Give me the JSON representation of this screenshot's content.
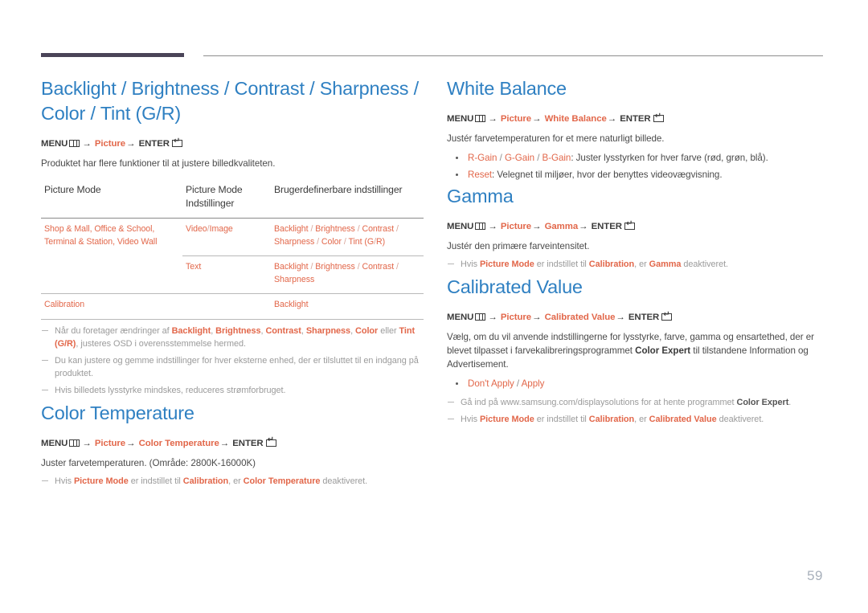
{
  "page": {
    "number": "59",
    "accent_blue": "#2f80c2",
    "accent_orange": "#e2674a",
    "rule_dark": "#4a4458"
  },
  "menu_labels": {
    "menu": "MENU",
    "enter": "ENTER",
    "arrow": "→",
    "menu_icon": "menu-grid-icon",
    "enter_icon": "enter-key-icon"
  },
  "left": {
    "section1": {
      "title": "Backlight / Brightness / Contrast / Sharpness / Color / Tint (G/R)",
      "path": {
        "root": "Picture"
      },
      "intro": "Produktet har flere funktioner til at justere billedkvaliteten.",
      "table": {
        "headers": [
          "Picture Mode",
          "Picture Mode Indstillinger",
          "Brugerdefinerbare indstillinger"
        ],
        "rows": [
          {
            "mode": "Shop & Mall, Office & School, Terminal & Station, Video Wall",
            "setting": "Video/Image",
            "custom": "Backlight / Brightness / Contrast / Sharpness / Color / Tint (G/R)"
          },
          {
            "mode": "",
            "setting": "Text",
            "custom": "Backlight / Brightness / Contrast / Sharpness"
          },
          {
            "mode": "Calibration",
            "setting": "",
            "custom": "Backlight"
          }
        ]
      },
      "notes": [
        "Når du foretager ændringer af Backlight, Brightness, Contrast, Sharpness, Color eller Tint (G/R), justeres OSD i overensstemmelse hermed.",
        "Du kan justere og gemme indstillinger for hver eksterne enhed, der er tilsluttet til en indgang på produktet.",
        "Hvis billedets lysstyrke mindskes, reduceres strømforbruget."
      ]
    },
    "section2": {
      "title": "Color Temperature",
      "path": {
        "root": "Picture",
        "leaf": "Color Temperature"
      },
      "intro": "Juster farvetemperaturen. (Område: 2800K-16000K)",
      "note": "Hvis Picture Mode er indstillet til Calibration, er Color Temperature deaktiveret."
    }
  },
  "right": {
    "section1": {
      "title": "White Balance",
      "path": {
        "root": "Picture",
        "leaf": "White Balance"
      },
      "intro": "Justér farvetemperaturen for et mere naturligt billede.",
      "bullets": [
        {
          "term": "R-Gain / G-Gain / B-Gain",
          "desc": ": Juster lysstyrken for hver farve (rød, grøn, blå)."
        },
        {
          "term": "Reset",
          "desc": ": Velegnet til miljøer, hvor der benyttes videovægvisning."
        }
      ]
    },
    "section2": {
      "title": "Gamma",
      "path": {
        "root": "Picture",
        "leaf": "Gamma"
      },
      "intro": "Justér den primære farveintensitet.",
      "note": "Hvis Picture Mode er indstillet til Calibration, er Gamma deaktiveret."
    },
    "section3": {
      "title": "Calibrated Value",
      "path": {
        "root": "Picture",
        "leaf": "Calibrated Value"
      },
      "intro": "Vælg, om du vil anvende indstillingerne for lysstyrke, farve, gamma og ensartethed, der er blevet tilpasset i farvekalibreringsprogrammet Color Expert til tilstandene Information og Advertisement.",
      "bullets": [
        {
          "term": "Don't Apply / Apply",
          "desc": ""
        }
      ],
      "notes": [
        "Gå ind på www.samsung.com/displaysolutions for at hente programmet Color Expert.",
        "Hvis Picture Mode er indstillet til Calibration, er Calibrated Value deaktiveret."
      ]
    }
  }
}
